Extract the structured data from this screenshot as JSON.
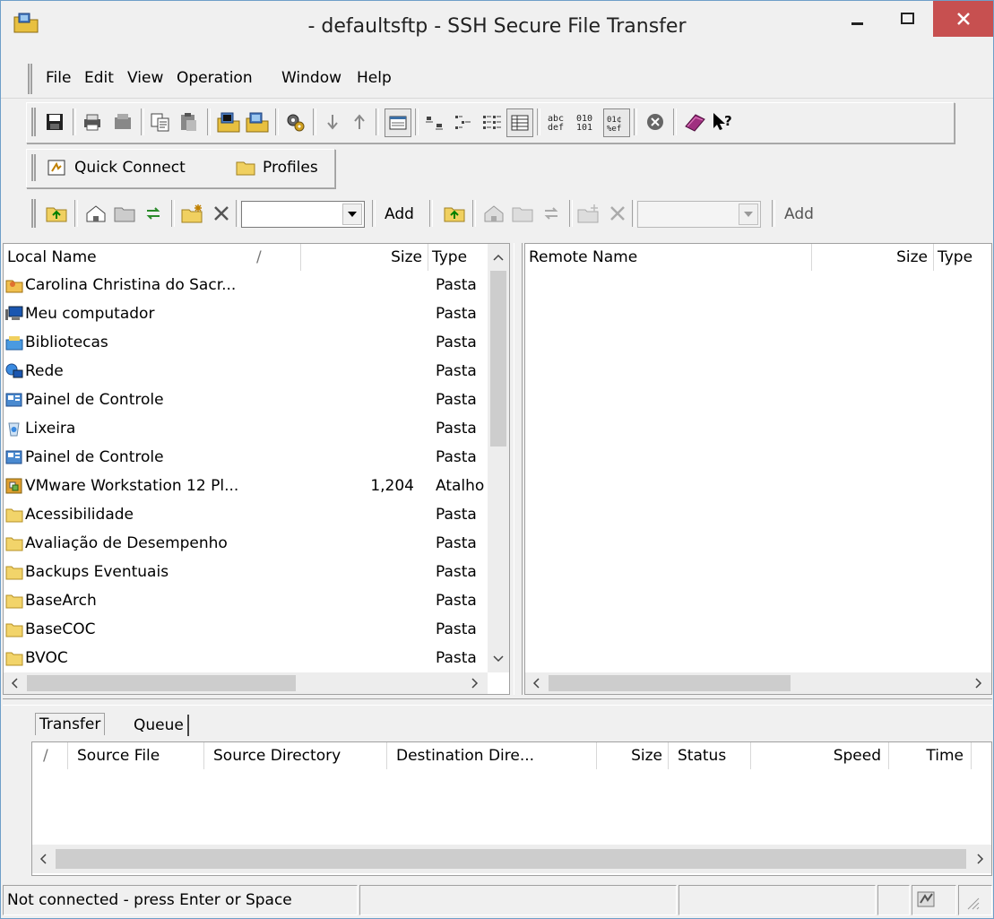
{
  "window": {
    "title": "- defaultsftp - SSH Secure File Transfer",
    "minimize": "–",
    "maximize": "☐",
    "close": "✕"
  },
  "menu": [
    "File",
    "Edit",
    "View",
    "Operation",
    "Window",
    "Help"
  ],
  "quick_toolbar": {
    "quick_connect": "Quick Connect",
    "profiles": "Profiles"
  },
  "local_bar": {
    "combo_value": "",
    "add": "Add"
  },
  "remote_bar": {
    "combo_value": "",
    "add": "Add"
  },
  "local": {
    "columns": {
      "name": "Local Name",
      "sort": "/",
      "size": "Size",
      "type": "Type"
    },
    "rows": [
      {
        "name": "Carolina Christina do Sacr...",
        "size": "",
        "type": "Pasta",
        "icon": "user-folder-icon"
      },
      {
        "name": "Meu computador",
        "size": "",
        "type": "Pasta",
        "icon": "computer-icon"
      },
      {
        "name": "Bibliotecas",
        "size": "",
        "type": "Pasta",
        "icon": "libraries-icon"
      },
      {
        "name": "Rede",
        "size": "",
        "type": "Pasta",
        "icon": "network-icon"
      },
      {
        "name": "Painel de Controle",
        "size": "",
        "type": "Pasta",
        "icon": "control-panel-icon"
      },
      {
        "name": "Lixeira",
        "size": "",
        "type": "Pasta",
        "icon": "recycle-bin-icon"
      },
      {
        "name": "Painel de Controle",
        "size": "",
        "type": "Pasta",
        "icon": "control-panel-icon"
      },
      {
        "name": "VMware Workstation 12 Pl...",
        "size": "1,204",
        "type": "Atalho",
        "icon": "vmware-shortcut-icon"
      },
      {
        "name": "Acessibilidade",
        "size": "",
        "type": "Pasta",
        "icon": "folder-icon"
      },
      {
        "name": "Avaliação de Desempenho",
        "size": "",
        "type": "Pasta",
        "icon": "folder-icon"
      },
      {
        "name": "Backups Eventuais",
        "size": "",
        "type": "Pasta",
        "icon": "folder-icon"
      },
      {
        "name": "BaseArch",
        "size": "",
        "type": "Pasta",
        "icon": "folder-icon"
      },
      {
        "name": "BaseCOC",
        "size": "",
        "type": "Pasta",
        "icon": "folder-icon"
      },
      {
        "name": "BVOC",
        "size": "",
        "type": "Pasta",
        "icon": "folder-icon"
      }
    ]
  },
  "remote": {
    "columns": {
      "name": "Remote Name",
      "size": "Size",
      "type": "Type"
    }
  },
  "transfer": {
    "tabs": [
      "Transfer",
      "Queue"
    ],
    "columns": {
      "sort": "/",
      "source_file": "Source File",
      "source_dir": "Source Directory",
      "dest_dir": "Destination Dire...",
      "size": "Size",
      "status": "Status",
      "speed": "Speed",
      "time": "Time"
    }
  },
  "statusbar": {
    "message": "Not connected - press Enter or Space"
  }
}
